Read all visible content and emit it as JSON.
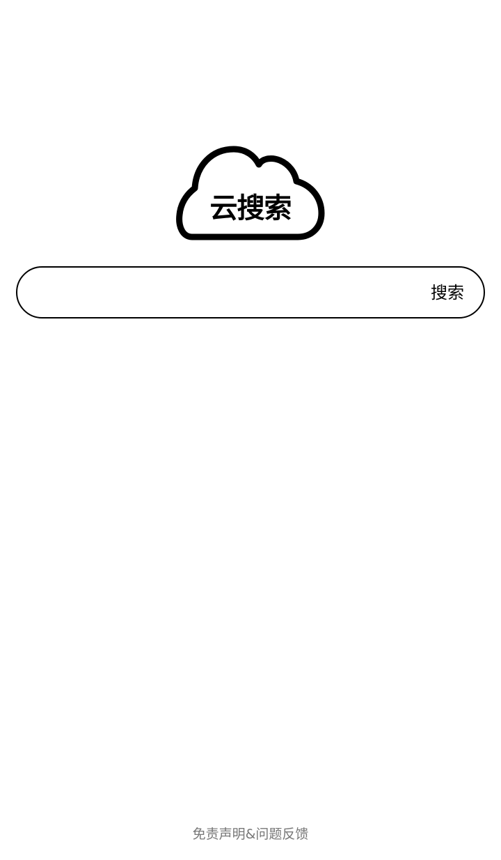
{
  "logo": {
    "text": "云搜索",
    "icon": "cloud-icon"
  },
  "search": {
    "value": "",
    "placeholder": "",
    "button_label": "搜索"
  },
  "footer": {
    "link_label": "免责声明&问题反馈"
  },
  "colors": {
    "background": "#ffffff",
    "primary": "#000000",
    "footer_text": "#777777"
  }
}
